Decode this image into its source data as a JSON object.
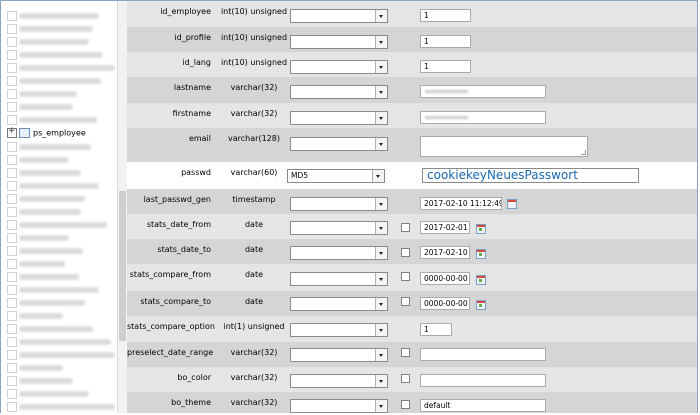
{
  "sidebar": {
    "active_table": "ps_employee"
  },
  "rows": [
    {
      "name": "id_employee",
      "type": "int(10) unsigned",
      "function": "",
      "null": false,
      "value": "1",
      "kind": "input"
    },
    {
      "name": "id_profile",
      "type": "int(10) unsigned",
      "function": "",
      "null": false,
      "value": "1",
      "kind": "input"
    },
    {
      "name": "id_lang",
      "type": "int(10) unsigned",
      "function": "",
      "null": false,
      "value": "1",
      "kind": "input"
    },
    {
      "name": "lastname",
      "type": "varchar(32)",
      "function": "",
      "null": false,
      "value": "",
      "kind": "blurred"
    },
    {
      "name": "firstname",
      "type": "varchar(32)",
      "function": "",
      "null": false,
      "value": "",
      "kind": "blurred"
    },
    {
      "name": "email",
      "type": "varchar(128)",
      "function": "",
      "null": false,
      "value": "",
      "kind": "textarea"
    },
    {
      "name": "passwd",
      "type": "varchar(60)",
      "function": "MD5",
      "null": false,
      "value": "cookiekeyNeuesPasswort",
      "kind": "password"
    },
    {
      "name": "last_passwd_gen",
      "type": "timestamp",
      "function": "",
      "null": false,
      "value": "2017-02-10 11:12:49",
      "kind": "date"
    },
    {
      "name": "stats_date_from",
      "type": "date",
      "function": "",
      "null": true,
      "value": "2017-02-01",
      "kind": "date"
    },
    {
      "name": "stats_date_to",
      "type": "date",
      "function": "",
      "null": true,
      "value": "2017-02-10",
      "kind": "date"
    },
    {
      "name": "stats_compare_from",
      "type": "date",
      "function": "",
      "null": true,
      "value": "0000-00-00",
      "kind": "date"
    },
    {
      "name": "stats_compare_to",
      "type": "date",
      "function": "",
      "null": true,
      "value": "0000-00-00",
      "kind": "date"
    },
    {
      "name": "stats_compare_option",
      "type": "int(1) unsigned",
      "function": "",
      "null": false,
      "value": "1",
      "kind": "input"
    },
    {
      "name": "preselect_date_range",
      "type": "varchar(32)",
      "function": "",
      "null": true,
      "value": "",
      "kind": "input"
    },
    {
      "name": "bo_color",
      "type": "varchar(32)",
      "function": "",
      "null": true,
      "value": "",
      "kind": "input"
    },
    {
      "name": "bo_theme",
      "type": "varchar(32)",
      "function": "",
      "null": true,
      "value": "default",
      "kind": "input"
    }
  ]
}
